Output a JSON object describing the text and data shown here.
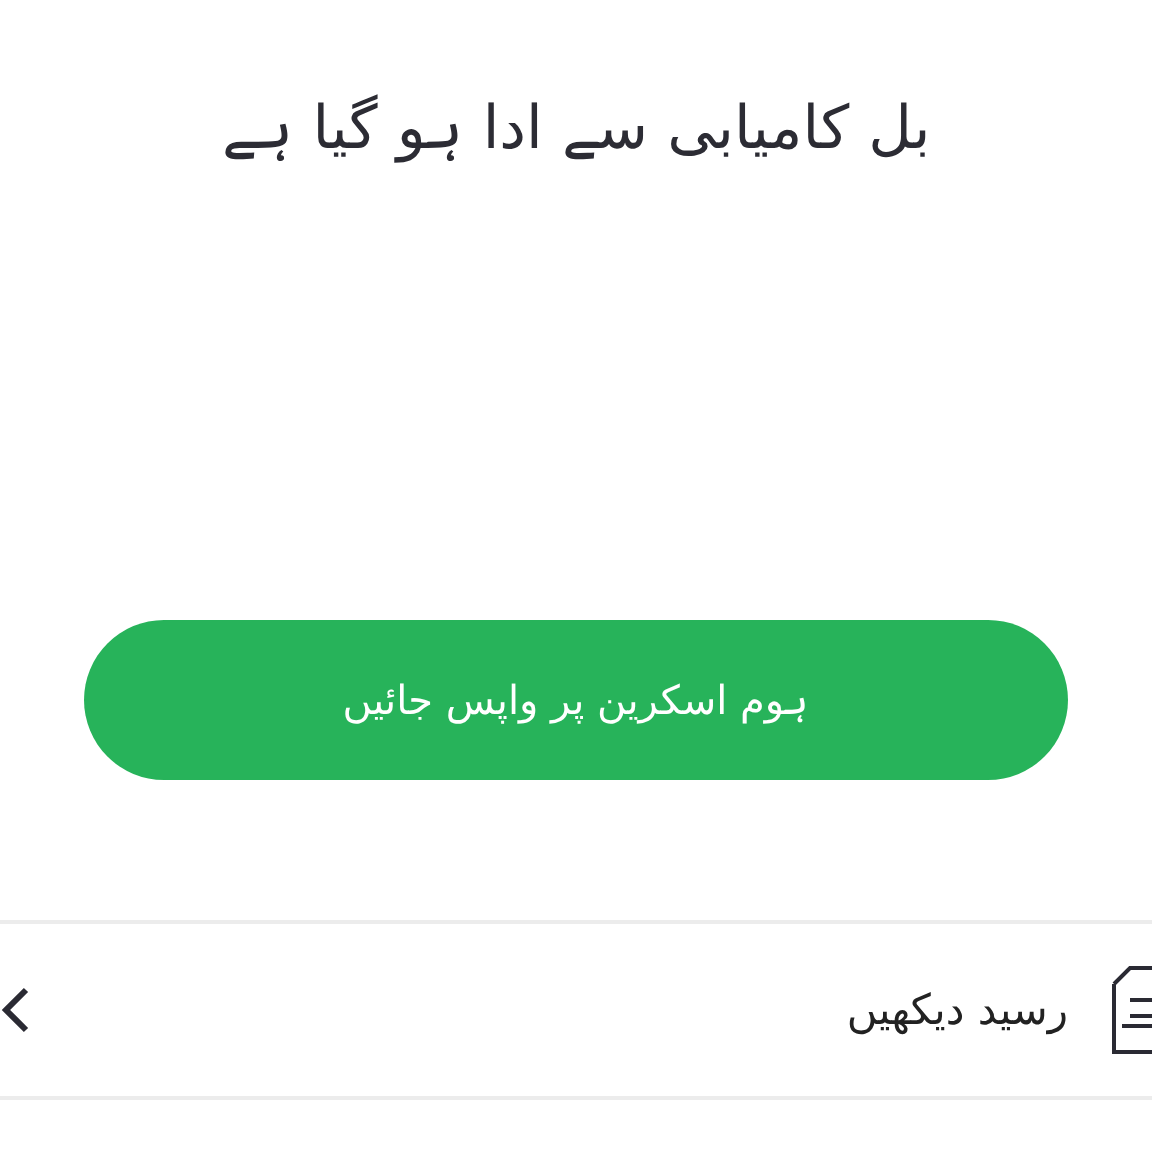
{
  "title": "بل کامیابی سے ادا ہو گیا ہے",
  "primary_button": {
    "label": "ہوم اسکرین پر واپس جائیں"
  },
  "receipt_row": {
    "label": "رسید دیکھیں"
  }
}
